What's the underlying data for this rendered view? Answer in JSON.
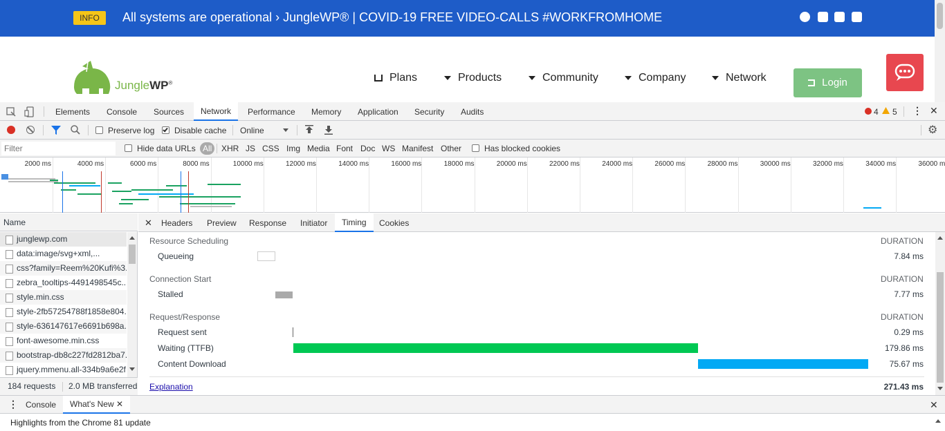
{
  "site": {
    "banner": {
      "badge": "INFO",
      "text": "All systems are operational › JungleWP® | COVID-19 FREE VIDEO-CALLS #WORKFROMHOME",
      "social_icons": [
        "wordpress-icon",
        "github-icon",
        "linkedin-icon",
        "twitter-icon"
      ]
    },
    "logo": {
      "part1": "Jungle",
      "part2": "WP",
      "mark": "®"
    },
    "nav": [
      {
        "label": "Plans",
        "icon": "cart-icon"
      },
      {
        "label": "Products",
        "icon": "caret-down-icon"
      },
      {
        "label": "Community",
        "icon": "caret-down-icon"
      },
      {
        "label": "Company",
        "icon": "caret-down-icon"
      },
      {
        "label": "Network",
        "icon": "caret-down-icon"
      }
    ],
    "login_label": "Login",
    "colors": {
      "banner": "#1e5cc8",
      "badge": "#f5c518",
      "login": "#7dc383",
      "chat": "#e8474f",
      "logo": "#7ab648"
    }
  },
  "devtools": {
    "tabs": [
      "Elements",
      "Console",
      "Sources",
      "Network",
      "Performance",
      "Memory",
      "Application",
      "Security",
      "Audits"
    ],
    "active_tab": "Network",
    "errors": "4",
    "warnings": "5",
    "toolbar": {
      "preserve_log": "Preserve log",
      "disable_cache": "Disable cache",
      "throttle": "Online"
    },
    "filter": {
      "placeholder": "Filter",
      "hide_data_urls": "Hide data URLs",
      "types": [
        "All",
        "XHR",
        "JS",
        "CSS",
        "Img",
        "Media",
        "Font",
        "Doc",
        "WS",
        "Manifest",
        "Other"
      ],
      "has_blocked_cookies": "Has blocked cookies"
    },
    "overview_ticks": [
      "2000 ms",
      "4000 ms",
      "6000 ms",
      "8000 ms",
      "10000 ms",
      "12000 ms",
      "14000 ms",
      "16000 ms",
      "18000 ms",
      "20000 ms",
      "22000 ms",
      "24000 ms",
      "26000 ms",
      "28000 ms",
      "30000 ms",
      "32000 ms",
      "34000 ms",
      "36000 ms"
    ],
    "name_header": "Name",
    "requests": [
      "junglewp.com",
      "data:image/svg+xml,...",
      "css?family=Reem%20Kufi%3...",
      "zebra_tooltips-4491498545c...",
      "style.min.css",
      "style-2fb57254788f1858e804...",
      "style-636147617e6691b698a...",
      "font-awesome.min.css",
      "bootstrap-db8c227fd2812ba7...",
      "jquery.mmenu.all-334b9a6e2f..."
    ],
    "summary": {
      "requests": "184 requests",
      "transferred": "2.0 MB transferred"
    },
    "detail_tabs": [
      "Headers",
      "Preview",
      "Response",
      "Initiator",
      "Timing",
      "Cookies"
    ],
    "active_detail_tab": "Timing",
    "timing": {
      "duration_label": "DURATION",
      "sections": [
        {
          "title": "Resource Scheduling",
          "rows": [
            {
              "label": "Queueing",
              "value": "7.84 ms"
            }
          ]
        },
        {
          "title": "Connection Start",
          "rows": [
            {
              "label": "Stalled",
              "value": "7.77 ms"
            }
          ]
        },
        {
          "title": "Request/Response",
          "rows": [
            {
              "label": "Request sent",
              "value": "0.29 ms"
            },
            {
              "label": "Waiting (TTFB)",
              "value": "179.86 ms"
            },
            {
              "label": "Content Download",
              "value": "75.67 ms"
            }
          ]
        }
      ],
      "explanation": "Explanation",
      "total": "271.43 ms",
      "colors": {
        "ttfb": "#00c853",
        "download": "#03a9f4",
        "stalled": "#aaaaaa"
      }
    },
    "drawer": {
      "tabs": [
        "Console",
        "What's New"
      ],
      "active": "What's New",
      "content": "Highlights from the Chrome 81 update"
    }
  }
}
